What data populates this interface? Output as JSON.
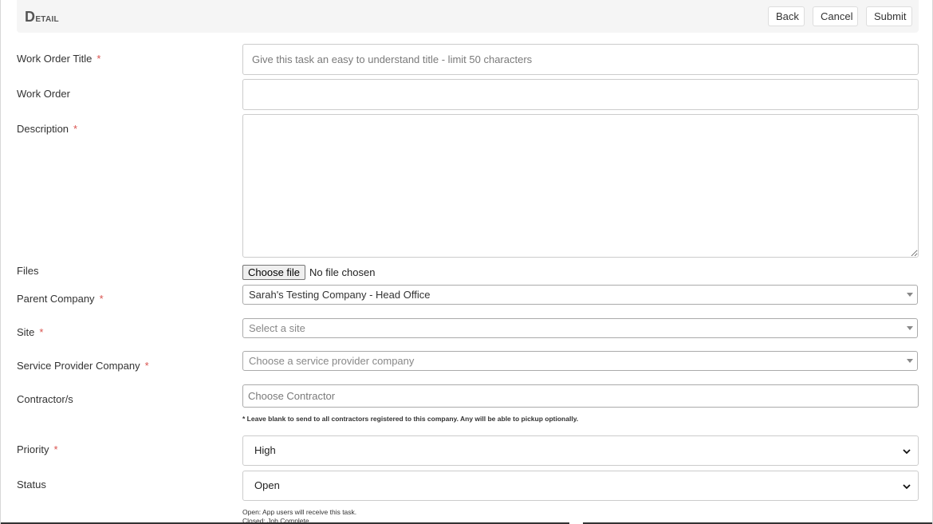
{
  "header": {
    "title": "Detail",
    "buttons": {
      "back": "Back",
      "cancel": "Cancel",
      "submit": "Submit"
    }
  },
  "form": {
    "required_mark": "*",
    "work_order_title": {
      "label": "Work Order Title",
      "placeholder": "Give this task an easy to understand title - limit 50 characters",
      "value": ""
    },
    "work_order": {
      "label": "Work Order",
      "value": ""
    },
    "description": {
      "label": "Description",
      "value": ""
    },
    "files": {
      "label": "Files",
      "button": "Choose file",
      "status": "No file chosen"
    },
    "parent_company": {
      "label": "Parent Company",
      "value": "Sarah's Testing Company - Head Office"
    },
    "site": {
      "label": "Site",
      "placeholder": "Select a site"
    },
    "service_provider_company": {
      "label": "Service Provider Company",
      "placeholder": "Choose a service provider company"
    },
    "contractors": {
      "label": "Contractor/s",
      "placeholder": "Choose Contractor",
      "hint": "* Leave blank to send to all contractors registered to this company. Any will be able to pickup optionally."
    },
    "priority": {
      "label": "Priority",
      "value": "High"
    },
    "status": {
      "label": "Status",
      "value": "Open",
      "hint_open": "Open: App users will receive this task.",
      "hint_closed": "Closed: Job Complete"
    }
  },
  "colors": {
    "required": "#d9534f",
    "header_bg": "#f5f5f5",
    "border": "#cccccc"
  }
}
